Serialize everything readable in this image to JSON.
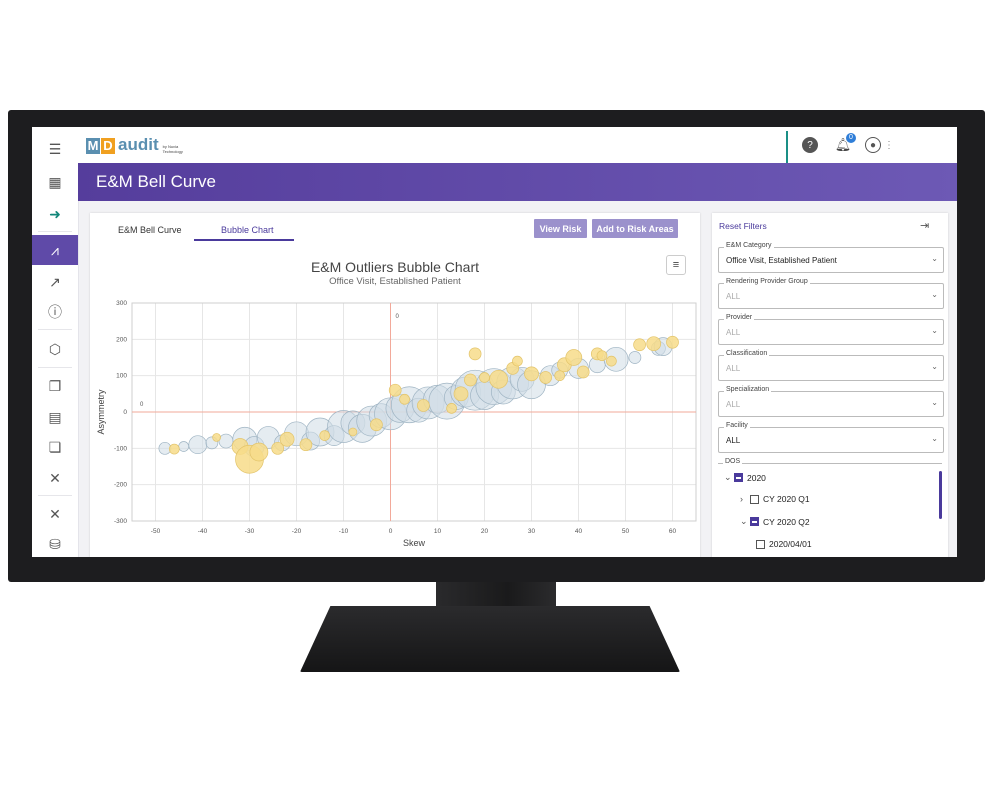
{
  "app": {
    "logo_text": "audit",
    "logo_m": "M",
    "logo_d": "D",
    "logo_by": "by Nuvia Technology",
    "notification_count": "0",
    "page_title": "E&M Bell Curve"
  },
  "tabs": [
    {
      "label": "E&M Bell Curve",
      "selected": false
    },
    {
      "label": "Bubble Chart",
      "selected": true
    }
  ],
  "buttons": {
    "view_risk": "View Risk",
    "add_to_risk_areas": "Add to Risk Areas"
  },
  "filters": {
    "reset_label": "Reset Filters",
    "fields": [
      {
        "label": "E&M Category",
        "value": "Office Visit, Established Patient",
        "placeholder": false
      },
      {
        "label": "Rendering Provider Group",
        "value": "ALL",
        "placeholder": true
      },
      {
        "label": "Provider",
        "value": "ALL",
        "placeholder": true
      },
      {
        "label": "Classification",
        "value": "ALL",
        "placeholder": true
      },
      {
        "label": "Specialization",
        "value": "ALL",
        "placeholder": true
      },
      {
        "label": "Facility",
        "value": "ALL",
        "placeholder": false
      }
    ],
    "dos": {
      "label": "DOS",
      "tree": [
        {
          "label": "2020",
          "level": 0,
          "expanded": true,
          "state": "partial"
        },
        {
          "label": "CY 2020 Q1",
          "level": 1,
          "expanded": false,
          "state": "none"
        },
        {
          "label": "CY 2020 Q2",
          "level": 1,
          "expanded": true,
          "state": "partial"
        },
        {
          "label": "2020/04/01",
          "level": 2,
          "expanded": false,
          "state": "none"
        }
      ]
    }
  },
  "colors": {
    "accent": "#5f4aa8",
    "band_start": "#553d9c",
    "band_end": "#6d59b5",
    "bubble_blue": "#cfdde6",
    "bubble_yellow": "#f7dc8a",
    "refline": "#f2a99a"
  },
  "chart_data": {
    "type": "scatter",
    "title": "E&M Outliers Bubble Chart",
    "subtitle": "Office Visit, Established Patient",
    "xlabel": "Skew",
    "ylabel": "Asymmetry",
    "xlim": [
      -55,
      65
    ],
    "ylim": [
      -300,
      300
    ],
    "x_ticks": [
      -50,
      -40,
      -30,
      -20,
      -10,
      0,
      10,
      20,
      30,
      40,
      50,
      60
    ],
    "y_ticks": [
      300,
      200,
      100,
      0,
      -100,
      -200,
      -300
    ],
    "reference_labels": [
      "0",
      "0"
    ],
    "grid": true,
    "series": [
      {
        "color": "blue",
        "points": [
          [
            -48,
            -100,
            6
          ],
          [
            -44,
            -95,
            5
          ],
          [
            -41,
            -90,
            9
          ],
          [
            -38,
            -85,
            6
          ],
          [
            -35,
            -80,
            7
          ],
          [
            -31,
            -75,
            12
          ],
          [
            -29,
            -95,
            10
          ],
          [
            -26,
            -70,
            11
          ],
          [
            -23,
            -85,
            8
          ],
          [
            -20,
            -60,
            12
          ],
          [
            -17,
            -80,
            9
          ],
          [
            -15,
            -55,
            14
          ],
          [
            -12,
            -65,
            10
          ],
          [
            -10,
            -40,
            16
          ],
          [
            -8,
            -30,
            12
          ],
          [
            -6,
            -45,
            14
          ],
          [
            -4,
            -25,
            15
          ],
          [
            -2,
            -10,
            12
          ],
          [
            0,
            -5,
            16
          ],
          [
            2,
            10,
            14
          ],
          [
            4,
            20,
            18
          ],
          [
            6,
            5,
            12
          ],
          [
            8,
            25,
            16
          ],
          [
            10,
            35,
            14
          ],
          [
            12,
            30,
            18
          ],
          [
            14,
            40,
            12
          ],
          [
            16,
            55,
            15
          ],
          [
            18,
            60,
            20
          ],
          [
            20,
            45,
            14
          ],
          [
            22,
            70,
            18
          ],
          [
            24,
            55,
            12
          ],
          [
            26,
            80,
            16
          ],
          [
            28,
            90,
            12
          ],
          [
            30,
            75,
            14
          ],
          [
            34,
            100,
            10
          ],
          [
            36,
            115,
            8
          ],
          [
            40,
            120,
            10
          ],
          [
            44,
            130,
            8
          ],
          [
            48,
            145,
            12
          ],
          [
            52,
            150,
            6
          ],
          [
            57,
            175,
            7
          ],
          [
            58,
            180,
            9
          ]
        ]
      },
      {
        "color": "yellow",
        "points": [
          [
            -46,
            -102,
            5
          ],
          [
            -37,
            -70,
            4
          ],
          [
            -32,
            -95,
            8
          ],
          [
            -30,
            -130,
            14
          ],
          [
            -28,
            -110,
            9
          ],
          [
            -24,
            -100,
            6
          ],
          [
            -22,
            -75,
            7
          ],
          [
            -18,
            -90,
            6
          ],
          [
            -14,
            -65,
            5
          ],
          [
            -8,
            -55,
            4
          ],
          [
            -3,
            -35,
            6
          ],
          [
            1,
            60,
            6
          ],
          [
            3,
            35,
            5
          ],
          [
            7,
            18,
            6
          ],
          [
            13,
            10,
            5
          ],
          [
            15,
            50,
            7
          ],
          [
            17,
            88,
            6
          ],
          [
            20,
            95,
            5
          ],
          [
            23,
            90,
            9
          ],
          [
            26,
            120,
            6
          ],
          [
            30,
            105,
            7
          ],
          [
            33,
            95,
            6
          ],
          [
            37,
            130,
            7
          ],
          [
            39,
            150,
            8
          ],
          [
            41,
            110,
            6
          ],
          [
            44,
            160,
            6
          ],
          [
            45,
            155,
            5
          ],
          [
            53,
            185,
            6
          ],
          [
            56,
            188,
            7
          ],
          [
            60,
            192,
            6
          ],
          [
            47,
            140,
            5
          ],
          [
            18,
            160,
            6
          ],
          [
            36,
            100,
            5
          ],
          [
            27,
            140,
            5
          ]
        ]
      }
    ]
  }
}
